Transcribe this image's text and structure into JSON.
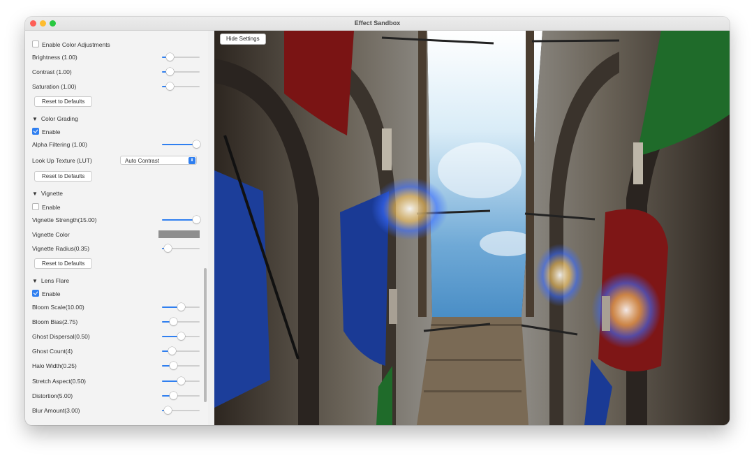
{
  "window": {
    "title": "Effect Sandbox"
  },
  "scene": {
    "hide_button": "Hide Settings"
  },
  "color_adjustments": {
    "enable_label": "Enable Color Adjustments",
    "enabled": false,
    "brightness": {
      "label": "Brightness (1.00)",
      "value": 0.2
    },
    "contrast": {
      "label": "Contrast (1.00)",
      "value": 0.2
    },
    "saturation": {
      "label": "Saturation (1.00)",
      "value": 0.2
    },
    "reset_label": "Reset to Defaults"
  },
  "color_grading": {
    "header": "Color Grading",
    "enable_label": "Enable",
    "enabled": true,
    "alpha_filtering": {
      "label": "Alpha Filtering (1.00)",
      "value": 0.9
    },
    "lut_label": "Look Up Texture (LUT)",
    "lut_value": "Auto Contrast",
    "reset_label": "Reset to Defaults"
  },
  "vignette": {
    "header": "Vignette",
    "enable_label": "Enable",
    "enabled": false,
    "strength": {
      "label": "Vignette Strength(15.00)",
      "value": 0.9
    },
    "color_label": "Vignette Color",
    "color": "#8e8e8e",
    "radius": {
      "label": "Vignette Radius(0.35)",
      "value": 0.14
    },
    "reset_label": "Reset to Defaults"
  },
  "lens_flare": {
    "header": "Lens Flare",
    "enable_label": "Enable",
    "enabled": true,
    "bloom_scale": {
      "label": "Bloom Scale(10.00)",
      "value": 0.5
    },
    "bloom_bias": {
      "label": "Bloom Bias(2.75)",
      "value": 0.3
    },
    "ghost_dispersal": {
      "label": "Ghost Dispersal(0.50)",
      "value": 0.5
    },
    "ghost_count": {
      "label": "Ghost Count(4)",
      "value": 0.25
    },
    "halo_width": {
      "label": "Halo Width(0.25)",
      "value": 0.3
    },
    "stretch_aspect": {
      "label": "Stretch Aspect(0.50)",
      "value": 0.5
    },
    "distortion": {
      "label": "Distortion(5.00)",
      "value": 0.3
    },
    "blur_amount": {
      "label": "Blur Amount(3.00)",
      "value": 0.14
    }
  },
  "colors": {
    "accent": "#2f7ff0",
    "panel_bg": "#f3f3f3"
  }
}
